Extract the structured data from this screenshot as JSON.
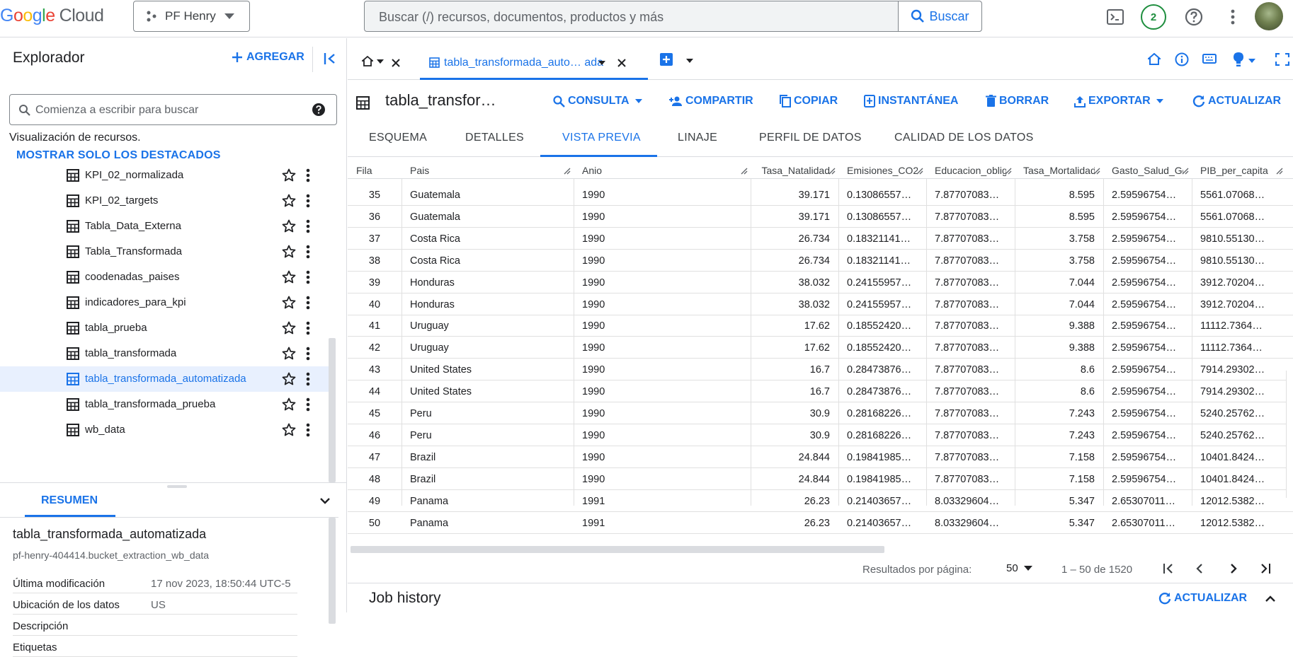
{
  "topbar": {
    "logo": {
      "g": "Google",
      "cloud": "Cloud"
    },
    "project": "PF Henry",
    "search_placeholder": "Buscar (/) recursos, documentos, productos y más",
    "search_button": "Buscar",
    "notifications_count": "2"
  },
  "explorer": {
    "title": "Explorador",
    "add_label": "AGREGAR",
    "search_placeholder": "Comienza a escribir para buscar",
    "resources_label": "Visualización de recursos.",
    "show_starred": "MOSTRAR SOLO LOS DESTACADOS",
    "items": [
      {
        "label": "KPI_02_normalizada"
      },
      {
        "label": "KPI_02_targets"
      },
      {
        "label": "Tabla_Data_Externa"
      },
      {
        "label": "Tabla_Transformada"
      },
      {
        "label": "coodenadas_paises"
      },
      {
        "label": "indicadores_para_kpi"
      },
      {
        "label": "tabla_prueba"
      },
      {
        "label": "tabla_transformada"
      },
      {
        "label": "tabla_transformada_automatizada",
        "selected": true
      },
      {
        "label": "tabla_transformada_prueba"
      },
      {
        "label": "wb_data"
      }
    ]
  },
  "summary": {
    "tab": "RESUMEN",
    "title": "tabla_transformada_automatizada",
    "subtitle": "pf-henry-404414.bucket_extraction_wb_data",
    "rows": [
      {
        "key": "Última modificación",
        "value": "17 nov 2023, 18:50:44 UTC-5"
      },
      {
        "key": "Ubicación de los datos",
        "value": "US"
      },
      {
        "key": "Descripción",
        "value": ""
      },
      {
        "key": "Etiquetas",
        "value": ""
      }
    ]
  },
  "tabs": {
    "active_label": "tabla_transformada_auto… ada"
  },
  "toolbar": {
    "table_name": "tabla_transfor…",
    "consulta": "CONSULTA",
    "compartir": "COMPARTIR",
    "copiar": "COPIAR",
    "instantanea": "INSTANTÁNEA",
    "borrar": "BORRAR",
    "exportar": "EXPORTAR",
    "actualizar": "ACTUALIZAR"
  },
  "subtabs": [
    "ESQUEMA",
    "DETALLES",
    "VISTA PREVIA",
    "LINAJE",
    "PERFIL DE DATOS",
    "CALIDAD DE LOS DATOS"
  ],
  "table": {
    "columns": [
      "Fila",
      "Pais",
      "Anio",
      "Tasa_Natalidad",
      "Emisiones_CO2",
      "Educacion_oblig",
      "Tasa_Mortalidad",
      "Gasto_Salud_Go",
      "PIB_per_capita"
    ],
    "rows": [
      [
        "35",
        "Guatemala",
        "1990",
        "39.171",
        "0.13086557…",
        "7.87707083…",
        "8.595",
        "2.59596754…",
        "5561.07068…"
      ],
      [
        "36",
        "Guatemala",
        "1990",
        "39.171",
        "0.13086557…",
        "7.87707083…",
        "8.595",
        "2.59596754…",
        "5561.07068…"
      ],
      [
        "37",
        "Costa Rica",
        "1990",
        "26.734",
        "0.18321141…",
        "7.87707083…",
        "3.758",
        "2.59596754…",
        "9810.55130…"
      ],
      [
        "38",
        "Costa Rica",
        "1990",
        "26.734",
        "0.18321141…",
        "7.87707083…",
        "3.758",
        "2.59596754…",
        "9810.55130…"
      ],
      [
        "39",
        "Honduras",
        "1990",
        "38.032",
        "0.24155957…",
        "7.87707083…",
        "7.044",
        "2.59596754…",
        "3912.70204…"
      ],
      [
        "40",
        "Honduras",
        "1990",
        "38.032",
        "0.24155957…",
        "7.87707083…",
        "7.044",
        "2.59596754…",
        "3912.70204…"
      ],
      [
        "41",
        "Uruguay",
        "1990",
        "17.62",
        "0.18552420…",
        "7.87707083…",
        "9.388",
        "2.59596754…",
        "11112.7364…"
      ],
      [
        "42",
        "Uruguay",
        "1990",
        "17.62",
        "0.18552420…",
        "7.87707083…",
        "9.388",
        "2.59596754…",
        "11112.7364…"
      ],
      [
        "43",
        "United States",
        "1990",
        "16.7",
        "0.28473876…",
        "7.87707083…",
        "8.6",
        "2.59596754…",
        "7914.29302…"
      ],
      [
        "44",
        "United States",
        "1990",
        "16.7",
        "0.28473876…",
        "7.87707083…",
        "8.6",
        "2.59596754…",
        "7914.29302…"
      ],
      [
        "45",
        "Peru",
        "1990",
        "30.9",
        "0.28168226…",
        "7.87707083…",
        "7.243",
        "2.59596754…",
        "5240.25762…"
      ],
      [
        "46",
        "Peru",
        "1990",
        "30.9",
        "0.28168226…",
        "7.87707083…",
        "7.243",
        "2.59596754…",
        "5240.25762…"
      ],
      [
        "47",
        "Brazil",
        "1990",
        "24.844",
        "0.19841985…",
        "7.87707083…",
        "7.158",
        "2.59596754…",
        "10401.8424…"
      ],
      [
        "48",
        "Brazil",
        "1990",
        "24.844",
        "0.19841985…",
        "7.87707083…",
        "7.158",
        "2.59596754…",
        "10401.8424…"
      ],
      [
        "49",
        "Panama",
        "1991",
        "26.23",
        "0.21403657…",
        "8.03329604…",
        "5.347",
        "2.65307011…",
        "12012.5382…"
      ],
      [
        "50",
        "Panama",
        "1991",
        "26.23",
        "0.21403657…",
        "8.03329604…",
        "5.347",
        "2.65307011…",
        "12012.5382…"
      ]
    ]
  },
  "pager": {
    "per_page_label": "Resultados por página:",
    "per_page_value": "50",
    "range": "1 – 50 de 1520"
  },
  "job_history": {
    "title": "Job history",
    "refresh": "ACTUALIZAR"
  },
  "colors": {
    "accent": "#1a73e8",
    "border": "#dadce0",
    "selected_row": "#e8f0fe"
  }
}
